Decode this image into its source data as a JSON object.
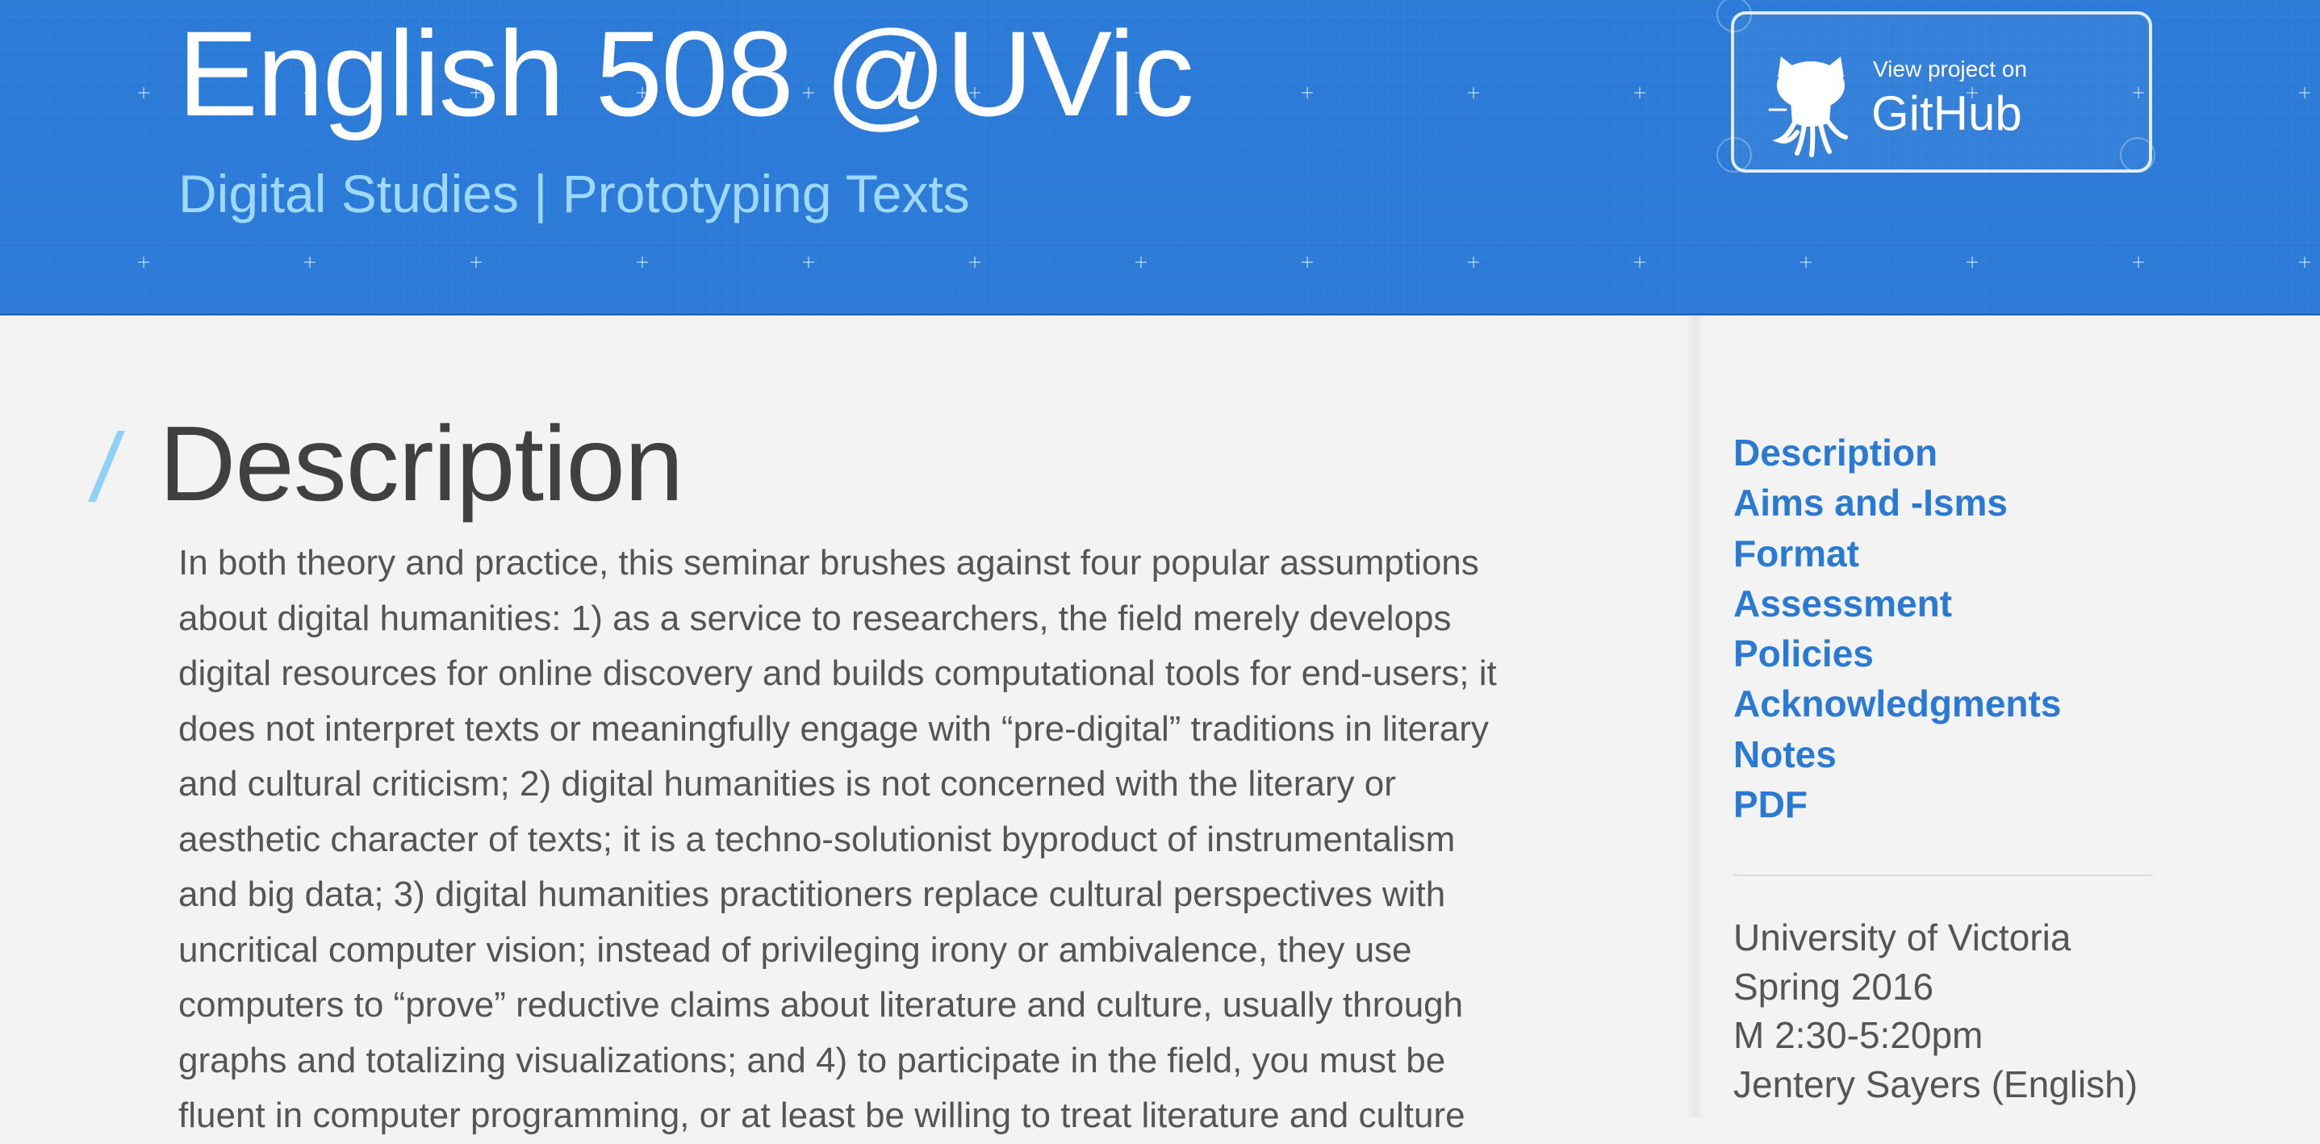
{
  "header": {
    "title": "English 508 @UVic",
    "subtitle": "Digital Studies | Prototyping Texts",
    "github_button": {
      "small_label": "View project on",
      "big_label": "GitHub",
      "icon": "github-octocat-icon"
    }
  },
  "main": {
    "section_marker": "/",
    "section_title": "Description",
    "body_lines": [
      "In both theory and practice, this seminar brushes against four popular assumptions",
      "about digital humanities: 1) as a service to researchers, the field merely develops",
      "digital resources for online discovery and builds computational tools for end-users; it",
      "does not interpret texts or meaningfully engage with “pre-digital” traditions in literary",
      "and cultural criticism; 2) digital humanities is not concerned with the literary or",
      "aesthetic character of texts; it is a techno-solutionist byproduct of instrumentalism",
      "and big data; 3) digital humanities practitioners replace cultural perspectives with",
      "uncritical computer vision; instead of privileging irony or ambivalence, they use",
      "computers to “prove” reductive claims about literature and culture, usually through",
      "graphs and totalizing visualizations; and 4) to participate in the field, you must be",
      "fluent in computer programming, or at least be willing to treat literature and culture"
    ]
  },
  "sidebar": {
    "nav": [
      {
        "label": "Description"
      },
      {
        "label": "Aims and -Isms"
      },
      {
        "label": "Format"
      },
      {
        "label": "Assessment"
      },
      {
        "label": "Policies"
      },
      {
        "label": "Acknowledgments"
      },
      {
        "label": "Notes"
      },
      {
        "label": "PDF"
      }
    ],
    "course_info": [
      "University of Victoria",
      "Spring 2016",
      "M 2:30-5:20pm",
      "Jentery Sayers (English)"
    ]
  },
  "colors": {
    "header_blue": "#2d7bd8",
    "subtitle_blue": "#9fd8ff",
    "link_blue": "#2a7ad4",
    "text_gray": "#555555",
    "heading_gray": "#404040",
    "page_bg": "#f3f3f3"
  }
}
